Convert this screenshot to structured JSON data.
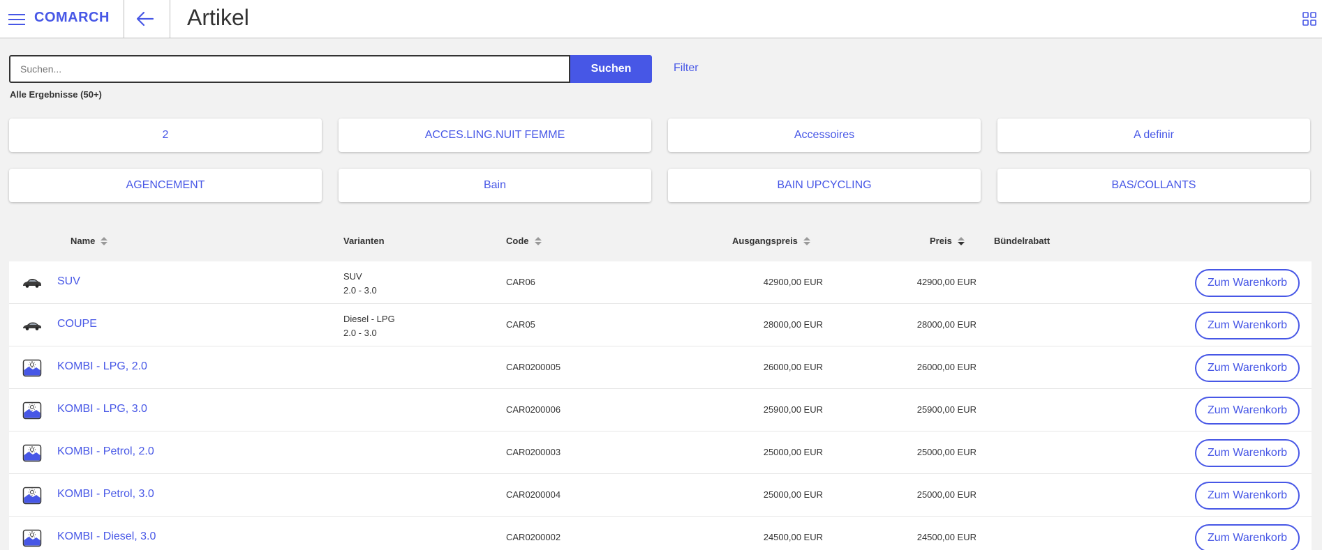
{
  "header": {
    "logo": "COMARCH",
    "title": "Artikel",
    "accent": "#4757e6"
  },
  "search": {
    "placeholder": "Suchen...",
    "value": "",
    "button_label": "Suchen",
    "filter_label": "Filter"
  },
  "results_label": "Alle Ergebnisse (50+)",
  "categories": [
    "2",
    "ACCES.LING.NUIT FEMME",
    "Accessoires",
    "A definir",
    "AGENCEMENT",
    "Bain",
    "BAIN UPCYCLING",
    "BAS/COLLANTS"
  ],
  "table": {
    "columns": {
      "name": "Name",
      "variants": "Varianten",
      "code": "Code",
      "base_price": "Ausgangspreis",
      "price": "Preis",
      "bundle": "Bündelrabatt"
    },
    "cart_label": "Zum Warenkorb",
    "rows": [
      {
        "name": "SUV",
        "icon": "car-icon",
        "variant1": "SUV",
        "variant2": "2.0 - 3.0",
        "code": "CAR06",
        "base_price": "42900,00 EUR",
        "price": "42900,00 EUR"
      },
      {
        "name": "COUPE",
        "icon": "car-icon",
        "variant1": "Diesel - LPG",
        "variant2": "2.0 - 3.0",
        "code": "CAR05",
        "base_price": "28000,00 EUR",
        "price": "28000,00 EUR"
      },
      {
        "name": "KOMBI - LPG, 2.0",
        "icon": "image-placeholder-icon",
        "variant1": "",
        "variant2": "",
        "code": "CAR0200005",
        "base_price": "26000,00 EUR",
        "price": "26000,00 EUR"
      },
      {
        "name": "KOMBI - LPG, 3.0",
        "icon": "image-placeholder-icon",
        "variant1": "",
        "variant2": "",
        "code": "CAR0200006",
        "base_price": "25900,00 EUR",
        "price": "25900,00 EUR"
      },
      {
        "name": "KOMBI - Petrol, 2.0",
        "icon": "image-placeholder-icon",
        "variant1": "",
        "variant2": "",
        "code": "CAR0200003",
        "base_price": "25000,00 EUR",
        "price": "25000,00 EUR"
      },
      {
        "name": "KOMBI - Petrol, 3.0",
        "icon": "image-placeholder-icon",
        "variant1": "",
        "variant2": "",
        "code": "CAR0200004",
        "base_price": "25000,00 EUR",
        "price": "25000,00 EUR"
      },
      {
        "name": "KOMBI - Diesel, 3.0",
        "icon": "image-placeholder-icon",
        "variant1": "",
        "variant2": "",
        "code": "CAR0200002",
        "base_price": "24500,00 EUR",
        "price": "24500,00 EUR"
      }
    ]
  }
}
